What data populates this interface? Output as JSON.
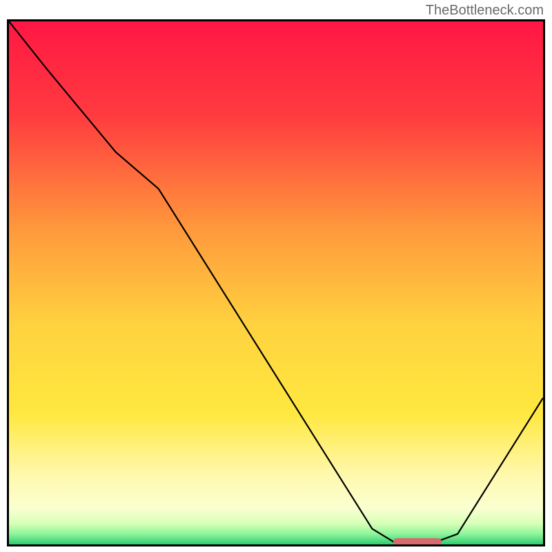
{
  "watermark": "TheBottleneck.com",
  "chart_data": {
    "type": "line",
    "title": "",
    "xlabel": "",
    "ylabel": "",
    "xlim": [
      0,
      100
    ],
    "ylim": [
      0,
      100
    ],
    "grid": false,
    "legend": false,
    "annotations": [],
    "series": [
      {
        "name": "curve",
        "x": [
          0,
          7,
          20,
          28,
          68,
          72,
          80,
          84,
          100
        ],
        "values": [
          100,
          91,
          75,
          68,
          3,
          0.5,
          0.5,
          2,
          28
        ]
      }
    ],
    "marker": {
      "x_start": 72,
      "x_end": 81,
      "y": 0.5
    },
    "gradient_stops": [
      {
        "pct": 0,
        "color": "#ff1744"
      },
      {
        "pct": 18,
        "color": "#ff3b3f"
      },
      {
        "pct": 40,
        "color": "#ff9a3c"
      },
      {
        "pct": 58,
        "color": "#ffd23f"
      },
      {
        "pct": 75,
        "color": "#ffe83f"
      },
      {
        "pct": 87,
        "color": "#fff9b0"
      },
      {
        "pct": 93,
        "color": "#fbffd0"
      },
      {
        "pct": 96,
        "color": "#d8ffb8"
      },
      {
        "pct": 98,
        "color": "#8df59a"
      },
      {
        "pct": 100,
        "color": "#2ecc71"
      }
    ]
  }
}
